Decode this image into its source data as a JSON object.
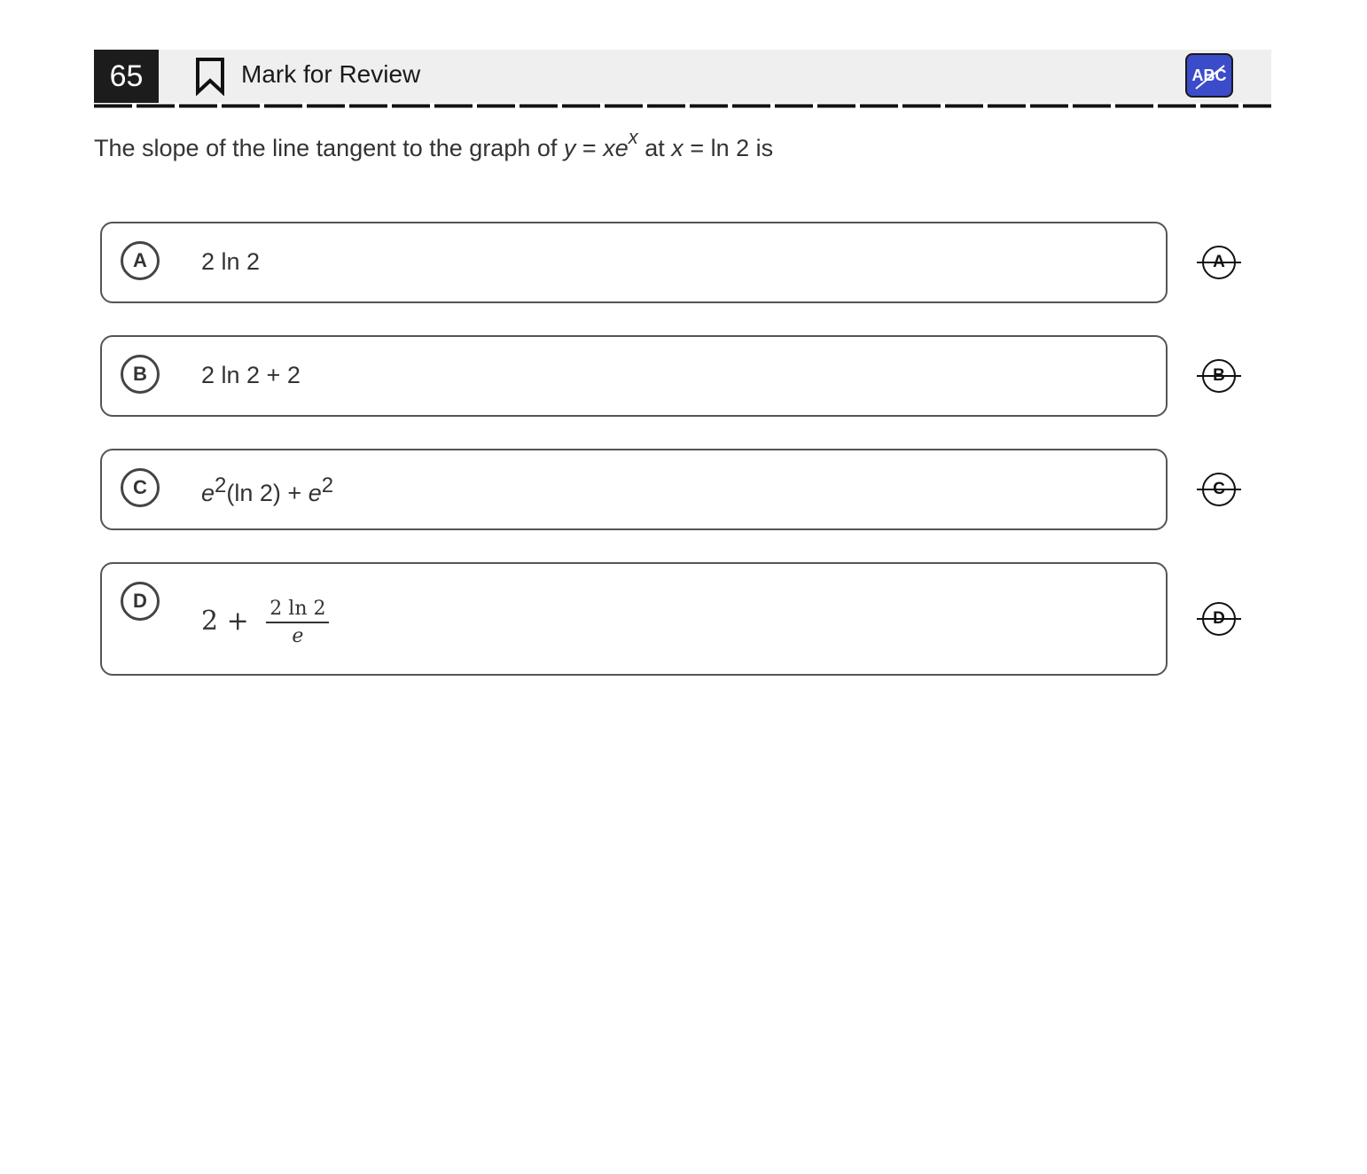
{
  "header": {
    "question_number": "65",
    "mark_for_review_label": "Mark for Review",
    "abc_button_label": "ABC"
  },
  "question": {
    "prefix": "The slope of the line tangent to the graph of",
    "equation_y": "y",
    "equation_eq1": "=",
    "equation_xe": "xe",
    "equation_exponent": "x",
    "middle": "at",
    "at_x": "x",
    "equation_eq2": "=",
    "at_value": "ln 2 is"
  },
  "choices": [
    {
      "letter": "A",
      "text": "2 ln 2"
    },
    {
      "letter": "B",
      "text": "2 ln 2 + 2"
    },
    {
      "letter": "C",
      "e1": "e",
      "exp1": "2",
      "middle": "(ln 2) + ",
      "e2": "e",
      "exp2": "2"
    },
    {
      "letter": "D",
      "lead": "2 + ",
      "numerator": "2 ln 2",
      "denominator": "e"
    }
  ]
}
